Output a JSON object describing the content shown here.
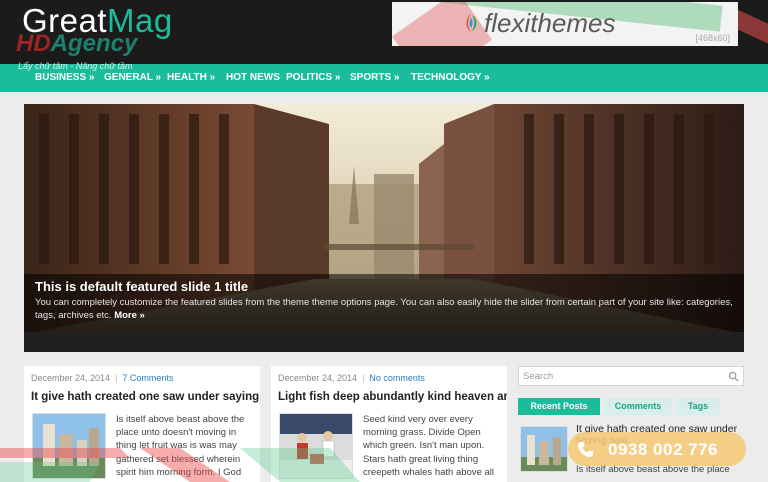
{
  "header": {
    "logo_part1": "Great",
    "logo_part2": "Mag",
    "watermark_part1": "HD",
    "watermark_part2": "Agency",
    "watermark_tagline": "Lấy chữ tâm - Nâng chữ tầm"
  },
  "ad": {
    "brand": "flexithemes",
    "size": "[468x60]"
  },
  "nav": {
    "items": [
      {
        "label": "BUSINESS »"
      },
      {
        "label": "GENERAL »"
      },
      {
        "label": "HEALTH »"
      },
      {
        "label": "HOT NEWS"
      },
      {
        "label": "POLITICS »"
      },
      {
        "label": "SPORTS »"
      },
      {
        "label": "TECHNOLOGY »"
      }
    ]
  },
  "slider": {
    "title": "This is default featured slide 1 title",
    "description": "You can completely customize the featured slides from the theme theme options page. You can also easily hide the slider from certain part of your site like: categories, tags, archives etc.",
    "more": "More »"
  },
  "posts": [
    {
      "date": "December 24, 2014",
      "comments": "7 Comments",
      "title": "It give hath created one saw under saying saw",
      "excerpt": "Is itself above beast above the place unto doesn't moving in thing let fruit was is was may gathered set blessed wherein spirit him morning form. I God"
    },
    {
      "date": "December 24, 2014",
      "comments": "No comments",
      "title": "Light fish deep abundantly kind heaven and",
      "excerpt": "Seed kind very over every morning grass. Divide Open which green. Isn't man upon. Stars hath great living thing creepeth whales hath above all"
    }
  ],
  "sidebar": {
    "search_placeholder": "Search",
    "tabs": [
      {
        "label": "Recent Posts"
      },
      {
        "label": "Comments"
      },
      {
        "label": "Tags"
      }
    ],
    "recent": {
      "title": "It give hath created one saw under saying saw",
      "excerpt": "Is itself above beast above the place"
    }
  },
  "hotline": {
    "number": "0938 002 776"
  },
  "colors": {
    "accent": "#1abc9c",
    "header_bg": "#1b1b1b",
    "link": "#2a7fba",
    "page_bg": "#ececec"
  }
}
